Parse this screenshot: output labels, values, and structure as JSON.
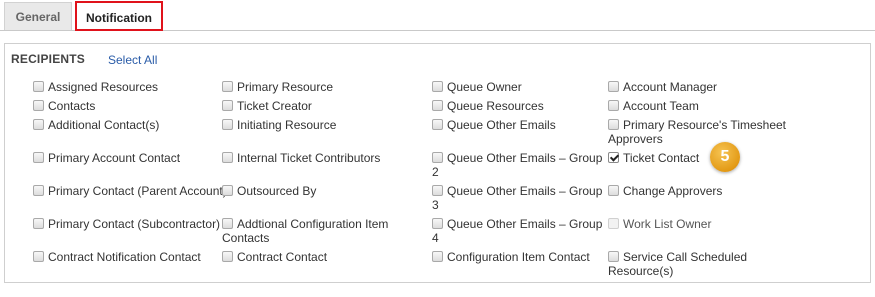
{
  "tabs": [
    {
      "label": "General"
    },
    {
      "label": "Notification"
    }
  ],
  "recipients": {
    "title": "RECIPIENTS",
    "select_all": "Select All",
    "items": [
      {
        "label": "Assigned Resources",
        "checked": false
      },
      {
        "label": "Primary Resource",
        "checked": false
      },
      {
        "label": "Queue Owner",
        "checked": false
      },
      {
        "label": "Account Manager",
        "checked": false
      },
      {
        "label": "Contacts",
        "checked": false
      },
      {
        "label": "Ticket Creator",
        "checked": false
      },
      {
        "label": "Queue Resources",
        "checked": false
      },
      {
        "label": "Account Team",
        "checked": false
      },
      {
        "label": "Additional Contact(s)",
        "checked": false
      },
      {
        "label": "Initiating Resource",
        "checked": false
      },
      {
        "label": "Queue Other Emails",
        "checked": false
      },
      {
        "label": "Primary Resource's Timesheet Approvers",
        "checked": false
      },
      {
        "label": "Primary Account Contact",
        "checked": false
      },
      {
        "label": "Internal Ticket Contributors",
        "checked": false
      },
      {
        "label": "Queue Other Emails – Group 2",
        "checked": false
      },
      {
        "label": "Ticket Contact",
        "checked": true
      },
      {
        "label": "Primary Contact (Parent Account)",
        "checked": false
      },
      {
        "label": "Outsourced By",
        "checked": false
      },
      {
        "label": "Queue Other Emails – Group 3",
        "checked": false
      },
      {
        "label": "Change Approvers",
        "checked": false
      },
      {
        "label": "Primary Contact (Subcontractor)",
        "checked": false
      },
      {
        "label": "Addtional Configuration Item Contacts",
        "checked": false
      },
      {
        "label": "Queue Other Emails – Group 4",
        "checked": false
      },
      {
        "label": "Work List Owner",
        "checked": false,
        "disabled": true
      },
      {
        "label": "Contract Notification Contact",
        "checked": false
      },
      {
        "label": "Contract Contact",
        "checked": false
      },
      {
        "label": "Configuration Item Contact",
        "checked": false
      },
      {
        "label": "Service Call Scheduled Resource(s)",
        "checked": false
      }
    ]
  },
  "badge": {
    "text": "5"
  },
  "colors": {
    "highlight": "#e0121b",
    "badge": "#e8a21c",
    "link": "#2a5ca8"
  }
}
